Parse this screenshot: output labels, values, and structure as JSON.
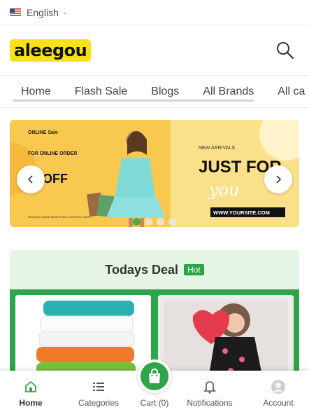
{
  "language": {
    "label": "English"
  },
  "brand": {
    "logo_text": "aleegou",
    "accent": "#2ea54a",
    "logo_bg": "#f7e21a"
  },
  "nav": {
    "items": [
      "Home",
      "Flash Sale",
      "Blogs",
      "All Brands",
      "All ca"
    ]
  },
  "banner": {
    "left_brand": "ONLINE Sale",
    "for_text": "FOR ONLINE ORDER",
    "off_text": "% OFF",
    "address": "BUILDING NAME MAIN ROAD, COUNTRY, 40872",
    "new_arrivals": "NEW ARRIVALS",
    "just_for": "JUST FOR",
    "you": "you",
    "website": "WWW.YOURSITE.COM",
    "slides": 4,
    "active_slide": 1
  },
  "deal": {
    "title": "Todays Deal",
    "badge": "Hot"
  },
  "bottom_nav": {
    "home": "Home",
    "categories": "Categories",
    "cart": "Cart (0)",
    "notifications": "Notifications",
    "account": "Account"
  },
  "icons": [
    "us-flag-icon",
    "chevron-down-icon",
    "search-icon",
    "chevron-left-icon",
    "chevron-right-icon",
    "home-icon",
    "list-icon",
    "shopping-bag-icon",
    "bell-icon",
    "avatar-icon"
  ]
}
